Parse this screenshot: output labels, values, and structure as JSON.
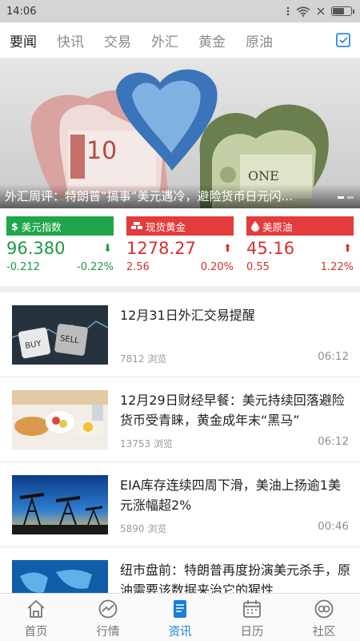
{
  "status_bar": {
    "time": "14:06"
  },
  "tabs": [
    {
      "label": "要闻",
      "active": true
    },
    {
      "label": "快讯",
      "active": false
    },
    {
      "label": "交易",
      "active": false
    },
    {
      "label": "外汇",
      "active": false
    },
    {
      "label": "黄金",
      "active": false
    },
    {
      "label": "原油",
      "active": false
    }
  ],
  "banner": {
    "caption": "外汇周评：特朗普“搞事”美元遇冷，避险货币日元闪...",
    "slide_count": 2,
    "active_slide": 1
  },
  "quotes": [
    {
      "name": "美元指数",
      "icon": "dollar-icon",
      "price": "96.380",
      "change": "-0.212",
      "pct": "-0.22%",
      "direction": "down",
      "color": "#1fa64a"
    },
    {
      "name": "现货黄金",
      "icon": "gold-bars-icon",
      "price": "1278.27",
      "change": "2.56",
      "pct": "0.20%",
      "direction": "up",
      "color": "#e43c3c"
    },
    {
      "name": "美原油",
      "icon": "oil-drop-icon",
      "price": "45.16",
      "change": "0.55",
      "pct": "1.22%",
      "direction": "up",
      "color": "#e43c3c"
    }
  ],
  "news": [
    {
      "title": "12月31日外汇交易提醒",
      "views": "7812 浏览",
      "time": "06:12",
      "thumb": "buy-sell-dice"
    },
    {
      "title": "12月29日财经早餐：美元持续回落避险货币受青睐，黄金成年末“黑马”",
      "views": "13753 浏览",
      "time": "06:12",
      "thumb": "breakfast"
    },
    {
      "title": "EIA库存连续四周下滑，美油上扬逾1美元涨幅超2%",
      "views": "5890 浏览",
      "time": "00:46",
      "thumb": "oil-pumps"
    },
    {
      "title": "纽市盘前：特朗普再度扮演美元杀手，原油需要该数据来治它的猩性",
      "views": "",
      "time": "",
      "thumb": "world-map"
    }
  ],
  "bottom_nav": [
    {
      "label": "首页",
      "icon": "home-icon",
      "active": false
    },
    {
      "label": "行情",
      "icon": "chart-icon",
      "active": false
    },
    {
      "label": "资讯",
      "icon": "news-icon",
      "active": true
    },
    {
      "label": "日历",
      "icon": "calendar-icon",
      "active": false
    },
    {
      "label": "社区",
      "icon": "community-icon",
      "active": false
    }
  ],
  "colors": {
    "accent": "#1b7ed8",
    "up": "#d8302f",
    "down": "#1c9a45"
  }
}
